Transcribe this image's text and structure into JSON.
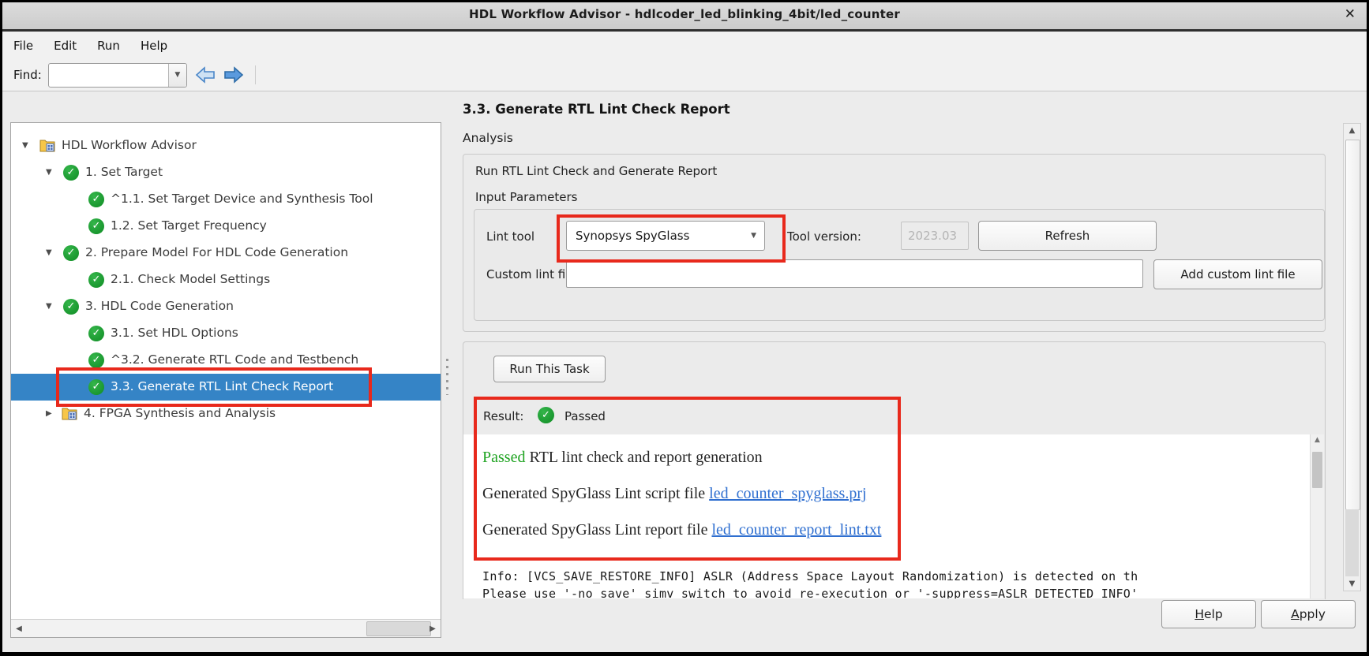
{
  "window": {
    "title": "HDL Workflow Advisor - hdlcoder_led_blinking_4bit/led_counter",
    "close": "✕"
  },
  "menu": {
    "file": "File",
    "edit": "Edit",
    "run": "Run",
    "help": "Help"
  },
  "find": {
    "label": "Find:",
    "value": ""
  },
  "tree": {
    "items": [
      {
        "label": "HDL Workflow Advisor",
        "depth": 0,
        "icon": "advisor-folder",
        "state": "expanded"
      },
      {
        "label": "1. Set Target",
        "depth": 1,
        "icon": "passed-check",
        "state": "expanded"
      },
      {
        "label": "^1.1. Set Target Device and Synthesis Tool",
        "depth": 2,
        "icon": "passed-check"
      },
      {
        "label": "1.2. Set Target Frequency",
        "depth": 2,
        "icon": "passed-check"
      },
      {
        "label": "2. Prepare Model For HDL Code Generation",
        "depth": 1,
        "icon": "passed-check",
        "state": "expanded"
      },
      {
        "label": "2.1. Check Model Settings",
        "depth": 2,
        "icon": "passed-check"
      },
      {
        "label": "3. HDL Code Generation",
        "depth": 1,
        "icon": "passed-check",
        "state": "expanded"
      },
      {
        "label": "3.1. Set HDL Options",
        "depth": 2,
        "icon": "passed-check"
      },
      {
        "label": "^3.2. Generate RTL Code and Testbench",
        "depth": 2,
        "icon": "passed-check"
      },
      {
        "label": "3.3. Generate RTL Lint Check Report",
        "depth": 2,
        "icon": "passed-check",
        "selected": true,
        "annotated": true
      },
      {
        "label": "4. FPGA Synthesis and Analysis",
        "depth": 1,
        "icon": "advisor-folder",
        "state": "collapsed"
      }
    ]
  },
  "panel": {
    "heading": "3.3. Generate RTL Lint Check Report",
    "analysis_label": "Analysis",
    "description": "Run RTL Lint Check and Generate Report",
    "input_parameters_label": "Input Parameters",
    "lint_tool_label": "Lint tool",
    "lint_tool_value": "Synopsys SpyGlass",
    "tool_version_label": "Tool version:",
    "tool_version_value": "2023.03",
    "refresh_button": "Refresh",
    "custom_lint_file_label": "Custom lint file",
    "custom_lint_file_value": "",
    "add_custom_button": "Add custom lint file",
    "run_button": "Run This Task",
    "result_label": "Result:",
    "result_status": "Passed",
    "log": {
      "line1_status": "Passed",
      "line1_text": " RTL lint check and report generation",
      "line2_text": "Generated SpyGlass Lint script file ",
      "line2_link": "led_counter_spyglass.prj",
      "line3_text": "Generated SpyGlass Lint report file ",
      "line3_link": "led_counter_report_lint.txt",
      "console_line1": "Info: [VCS_SAVE_RESTORE_INFO] ASLR (Address Space Layout Randomization) is detected on th",
      "console_line2": "Please use '-no_save' simv switch to avoid re-execution or '-suppress=ASLR_DETECTED_INFO'"
    },
    "help_button": "Help",
    "apply_button": "Apply"
  },
  "colors": {
    "selection_blue": "#3584c6",
    "annotation_red": "#e8291c",
    "passed_green": "#1fa321",
    "link_blue": "#2f6fd0"
  }
}
